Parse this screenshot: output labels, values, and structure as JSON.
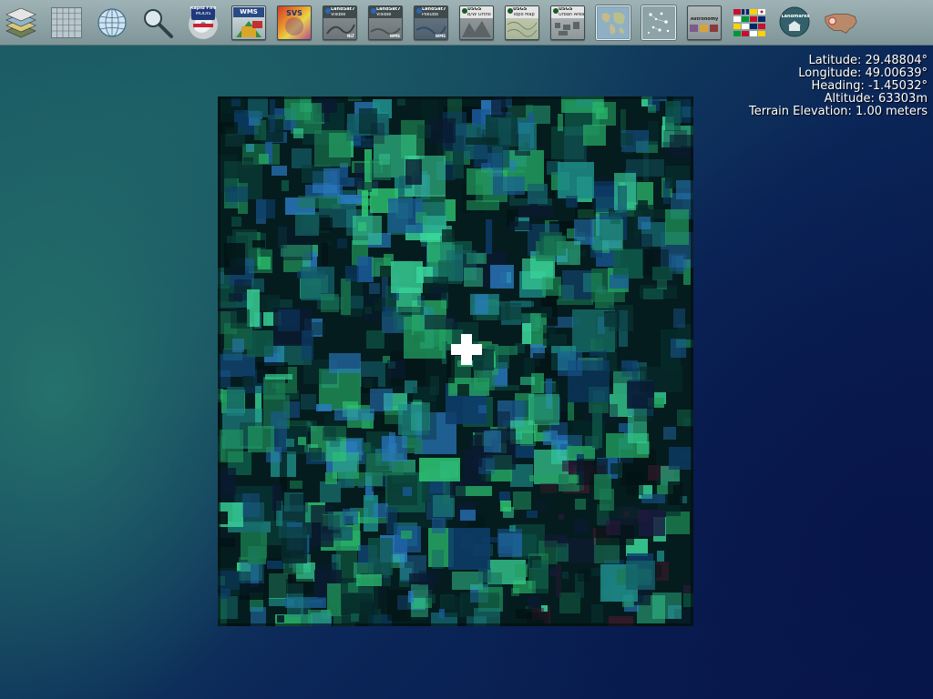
{
  "app": {
    "toolbar": {
      "buttons": [
        {
          "id": "layers",
          "icon": "layer-stack-icon",
          "label": "",
          "sub": ""
        },
        {
          "id": "grid",
          "icon": "lat-lon-grid-icon",
          "label": "",
          "sub": ""
        },
        {
          "id": "globe",
          "icon": "globe-icon",
          "label": "",
          "sub": ""
        },
        {
          "id": "search",
          "icon": "magnifier-icon",
          "label": "",
          "sub": ""
        },
        {
          "id": "modis",
          "icon": "hurricane-modis-icon",
          "label": "Rapid Fire",
          "sub": "MODIS"
        },
        {
          "id": "wms",
          "icon": "wms-browser-icon",
          "label": "WMS",
          "sub": ""
        },
        {
          "id": "svs",
          "icon": "svs-icon",
          "label": "SVS",
          "sub": ""
        },
        {
          "id": "landsat-visible-nlt",
          "icon": "landsat-icon",
          "label": "LandSat7",
          "sub": "Visible",
          "corner": "NLT"
        },
        {
          "id": "landsat-visible-wms",
          "icon": "landsat-icon",
          "label": "LandSat7",
          "sub": "Visible",
          "corner": "WMS"
        },
        {
          "id": "landsat-pseudo",
          "icon": "landsat-icon",
          "label": "LandSat7",
          "sub": "Pseudo",
          "corner": "WMS"
        },
        {
          "id": "usgs-ortho",
          "icon": "usgs-ortho-icon",
          "label": "USGS",
          "sub": "B/W Ortho",
          "corner": ""
        },
        {
          "id": "usgs-topo",
          "icon": "usgs-topo-icon",
          "label": "USGS",
          "sub": "Topo Map",
          "corner": ""
        },
        {
          "id": "usgs-urban",
          "icon": "usgs-urban-icon",
          "label": "USGS",
          "sub": "Urban Area",
          "corner": ""
        },
        {
          "id": "world-map",
          "icon": "world-map-icon",
          "label": "",
          "sub": ""
        },
        {
          "id": "stars",
          "icon": "stars-icon",
          "label": "",
          "sub": ""
        },
        {
          "id": "astronomy",
          "icon": "astronomy-icon",
          "label": "Astronomy",
          "sub": ""
        },
        {
          "id": "flags",
          "icon": "flags-icon",
          "label": "",
          "sub": ""
        },
        {
          "id": "landmarks",
          "icon": "landmarks-icon",
          "label": "Landmarks",
          "sub": ""
        },
        {
          "id": "usa",
          "icon": "usa-map-icon",
          "label": "",
          "sub": ""
        }
      ]
    }
  },
  "readout": {
    "latitude": "Latitude: 29.48804°",
    "longitude": "Longitude: 49.00639°",
    "heading": "Heading: -1.45032°",
    "altitude": "Altitude: 63303m",
    "terrain": "Terrain Elevation: 1.00 meters"
  }
}
